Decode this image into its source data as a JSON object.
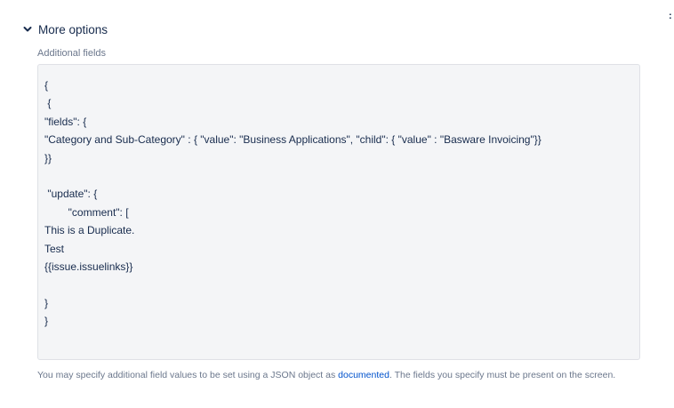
{
  "section": {
    "title": "More options",
    "chevron_icon": "chevron-down-icon",
    "stray_glyph": ":"
  },
  "additional_fields": {
    "label": "Additional fields",
    "lines": [
      "{",
      " {",
      "\"fields\": {",
      "\"Category and Sub-Category\" : { \"value\": \"Business Applications\", \"child\": { \"value\" : \"Basware Invoicing\"}}",
      "}}",
      "",
      " \"update\": {",
      "        \"comment\": [",
      "This is a Duplicate.",
      "Test",
      "{{issue.issuelinks}}",
      "",
      "}",
      "}"
    ]
  },
  "helper": {
    "text_before": "You may specify additional field values to be set using a JSON object as ",
    "link_text": "documented",
    "text_after": ". The fields you specify must be present on the screen."
  }
}
